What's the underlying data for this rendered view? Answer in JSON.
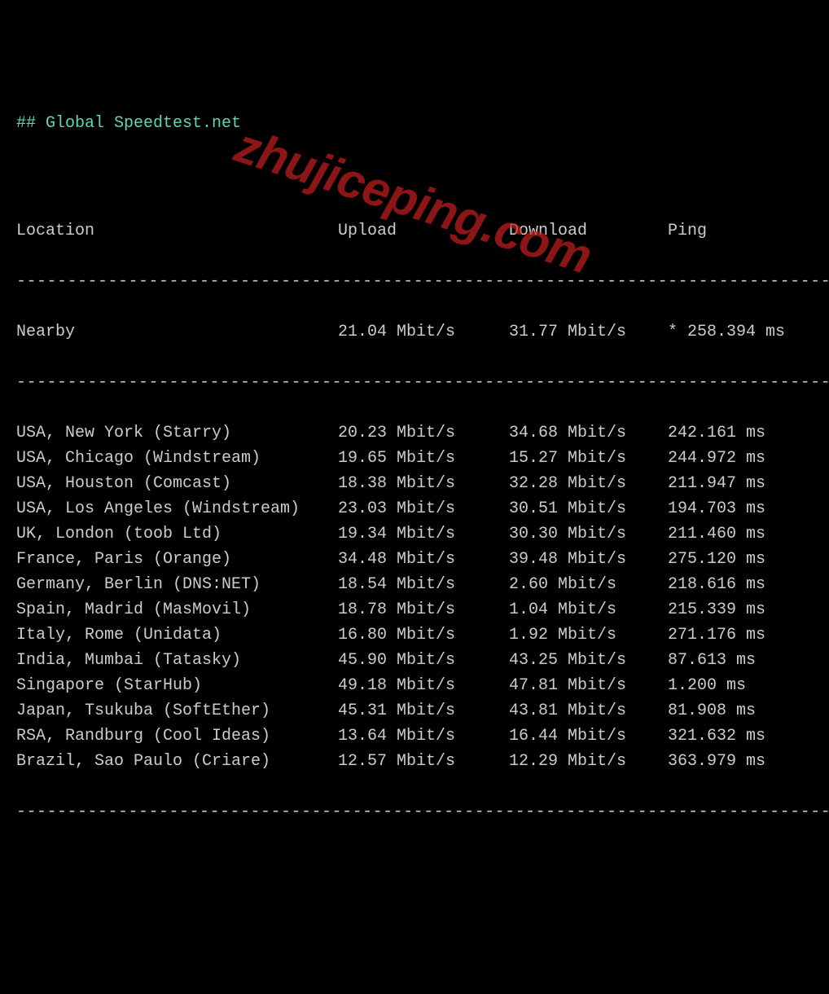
{
  "title": "## Global Speedtest.net",
  "headers": {
    "location": "Location",
    "upload": "Upload",
    "download": "Download",
    "ping": "Ping"
  },
  "divider": "---------------------------------------------------------------------------------",
  "nearby": {
    "location": "Nearby",
    "upload": "21.04 Mbit/s",
    "download": "31.77 Mbit/s",
    "ping": "* 258.394 ms"
  },
  "rows": [
    {
      "location": "USA, New York (Starry)",
      "upload": "20.23 Mbit/s",
      "download": "34.68 Mbit/s",
      "ping": "242.161 ms"
    },
    {
      "location": "USA, Chicago (Windstream)",
      "upload": "19.65 Mbit/s",
      "download": "15.27 Mbit/s",
      "ping": "244.972 ms"
    },
    {
      "location": "USA, Houston (Comcast)",
      "upload": "18.38 Mbit/s",
      "download": "32.28 Mbit/s",
      "ping": "211.947 ms"
    },
    {
      "location": "USA, Los Angeles (Windstream)",
      "upload": "23.03 Mbit/s",
      "download": "30.51 Mbit/s",
      "ping": "194.703 ms"
    },
    {
      "location": "UK, London (toob Ltd)",
      "upload": "19.34 Mbit/s",
      "download": "30.30 Mbit/s",
      "ping": "211.460 ms"
    },
    {
      "location": "France, Paris (Orange)",
      "upload": "34.48 Mbit/s",
      "download": "39.48 Mbit/s",
      "ping": "275.120 ms"
    },
    {
      "location": "Germany, Berlin (DNS:NET)",
      "upload": "18.54 Mbit/s",
      "download": "2.60 Mbit/s",
      "ping": "218.616 ms"
    },
    {
      "location": "Spain, Madrid (MasMovil)",
      "upload": "18.78 Mbit/s",
      "download": "1.04 Mbit/s",
      "ping": "215.339 ms"
    },
    {
      "location": "Italy, Rome (Unidata)",
      "upload": "16.80 Mbit/s",
      "download": "1.92 Mbit/s",
      "ping": "271.176 ms"
    },
    {
      "location": "India, Mumbai (Tatasky)",
      "upload": "45.90 Mbit/s",
      "download": "43.25 Mbit/s",
      "ping": "87.613 ms"
    },
    {
      "location": "Singapore (StarHub)",
      "upload": "49.18 Mbit/s",
      "download": "47.81 Mbit/s",
      "ping": "1.200 ms"
    },
    {
      "location": "Japan, Tsukuba (SoftEther)",
      "upload": "45.31 Mbit/s",
      "download": "43.81 Mbit/s",
      "ping": "81.908 ms"
    },
    {
      "location": "RSA, Randburg (Cool Ideas)",
      "upload": "13.64 Mbit/s",
      "download": "16.44 Mbit/s",
      "ping": "321.632 ms"
    },
    {
      "location": "Brazil, Sao Paulo (Criare)",
      "upload": "12.57 Mbit/s",
      "download": "12.29 Mbit/s",
      "ping": "363.979 ms"
    }
  ],
  "watermark": "zhujiceping.com"
}
